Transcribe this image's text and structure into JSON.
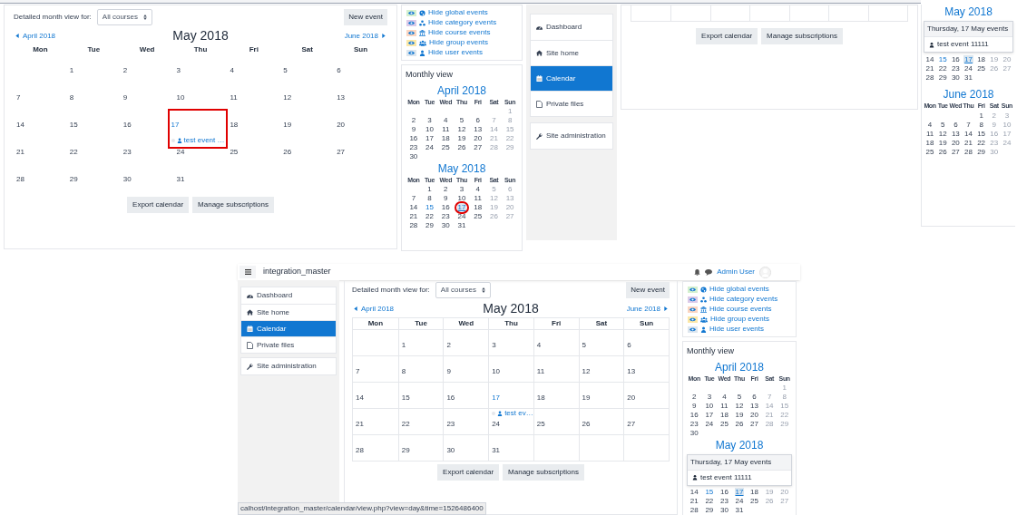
{
  "calendar_panel": {
    "filter_label": "Detailed month view for:",
    "course_select": "All courses",
    "new_event": "New event",
    "prev_month": "April 2018",
    "title": "May 2018",
    "next_month": "June 2018",
    "weekdays": [
      "Mon",
      "Tue",
      "Wed",
      "Thu",
      "Fri",
      "Sat",
      "Sun"
    ],
    "weeks": [
      [
        "1",
        "2",
        "3",
        "4",
        "5",
        "6"
      ],
      [
        "7",
        "8",
        "9",
        "10",
        "11",
        "12",
        "13"
      ],
      [
        "14",
        "15",
        "16",
        {
          "day": "17",
          "annotated": true,
          "events": [
            "test event …"
          ]
        },
        "18",
        "19",
        "20"
      ],
      [
        "21",
        "22",
        "23",
        "24",
        "25",
        "26",
        "27"
      ],
      [
        "28",
        "29",
        "30",
        "31"
      ]
    ],
    "buttons": [
      "Export calendar",
      "Manage subscriptions"
    ]
  },
  "side_blocks_panel": {
    "filters": [
      {
        "label": "Hide global events",
        "kind": "globe",
        "color": "#d4f0cf"
      },
      {
        "label": "Hide category events",
        "kind": "category",
        "color": "#dccbe9"
      },
      {
        "label": "Hide course events",
        "kind": "course",
        "color": "#fbd6c2"
      },
      {
        "label": "Hide group events",
        "kind": "group",
        "color": "#fce8a8"
      },
      {
        "label": "Hide user events",
        "kind": "user",
        "color": "#dde6ee"
      }
    ],
    "monthly_view": {
      "title": "Monthly view",
      "months": [
        {
          "title": "April 2018",
          "weekdays": [
            "Mon",
            "Tue",
            "Wed",
            "Thu",
            "Fri",
            "Sat",
            "Sun"
          ],
          "weeks": [
            [
              "1"
            ],
            [
              "2",
              "3",
              "4",
              "5",
              "6",
              "7",
              "8"
            ],
            [
              "9",
              "10",
              "11",
              "12",
              "13",
              "14",
              "15"
            ],
            [
              "16",
              "17",
              "18",
              "19",
              "20",
              "21",
              "22"
            ],
            [
              "23",
              "24",
              "25",
              "26",
              "27",
              "28",
              "29"
            ],
            [
              "30"
            ]
          ]
        },
        {
          "title": "May 2018",
          "weekdays": [
            "Mon",
            "Tue",
            "Wed",
            "Thu",
            "Fri",
            "Sat",
            "Sun"
          ],
          "weeks": [
            [
              "1",
              "2",
              "3",
              "4",
              "5",
              "6"
            ],
            [
              "7",
              "8",
              "9",
              "10",
              "11",
              "12",
              "13"
            ],
            [
              "14",
              {
                "d": "15",
                "kind": "event"
              },
              "16",
              {
                "d": "17",
                "kind": "today",
                "annotated": true
              },
              "18",
              "19",
              "20"
            ],
            [
              "21",
              "22",
              "23",
              "24",
              "25",
              "26",
              "27"
            ],
            [
              "28",
              "29",
              "30",
              "31"
            ]
          ]
        }
      ]
    }
  },
  "nav_panel": {
    "items": [
      {
        "label": "Dashboard",
        "kind": "dashboard",
        "selected": false
      },
      {
        "label": "Site home",
        "kind": "home",
        "selected": false
      },
      {
        "label": "Calendar",
        "kind": "calendar",
        "selected": true
      },
      {
        "label": "Private files",
        "kind": "files",
        "selected": false
      }
    ],
    "admin_items": [
      {
        "label": "Site administration",
        "kind": "admin",
        "selected": false
      }
    ]
  },
  "calendar_footer_panel": {
    "buttons": [
      "Export calendar",
      "Manage subscriptions"
    ]
  },
  "mini_calendar_panel": {
    "months": [
      {
        "title": "May 2018",
        "tooltip": {
          "title": "Thursday, 17 May events",
          "events": [
            "test event 11111"
          ]
        },
        "weeks": [
          [
            "14",
            {
              "d": "15",
              "kind": "event"
            },
            "16",
            {
              "d": "17",
              "kind": "today"
            },
            "18",
            "19",
            "20"
          ],
          [
            "21",
            "22",
            "23",
            "24",
            "25",
            "26",
            "27"
          ],
          [
            "28",
            "29",
            "30",
            "31"
          ]
        ]
      },
      {
        "title": "June 2018",
        "weekdays": [
          "Mon",
          "Tue",
          "Wed",
          "Thu",
          "Fri",
          "Sat",
          "Sun"
        ],
        "weeks": [
          [
            "1",
            "2",
            "3"
          ],
          [
            "4",
            "5",
            "6",
            "7",
            "8",
            "9",
            "10"
          ],
          [
            "11",
            "12",
            "13",
            "14",
            "15",
            "16",
            "17"
          ],
          [
            "18",
            "19",
            "20",
            "21",
            "22",
            "23",
            "24"
          ],
          [
            "25",
            "26",
            "27",
            "28",
            "29",
            "30"
          ]
        ]
      }
    ]
  },
  "moodle_page": {
    "header": {
      "site_name": "integration_master",
      "user_name": "Admin User"
    },
    "nav": {
      "items": [
        {
          "label": "Dashboard",
          "kind": "dashboard",
          "selected": false
        },
        {
          "label": "Site home",
          "kind": "home",
          "selected": false
        },
        {
          "label": "Calendar",
          "kind": "calendar",
          "selected": true
        },
        {
          "label": "Private files",
          "kind": "files",
          "selected": false
        }
      ],
      "admin_items": [
        {
          "label": "Site administration",
          "kind": "admin",
          "selected": false
        }
      ]
    },
    "calendar": {
      "filter_label": "Detailed month view for:",
      "course_select": "All courses",
      "new_event": "New event",
      "prev_month": "April 2018",
      "title": "May 2018",
      "next_month": "June 2018",
      "weekdays": [
        "Mon",
        "Tue",
        "Wed",
        "Thu",
        "Fri",
        "Sat",
        "Sun"
      ],
      "weeks": [
        [
          "1",
          "2",
          "3",
          "4",
          "5",
          "6"
        ],
        [
          "7",
          "8",
          "9",
          "10",
          "11",
          "12",
          "13"
        ],
        [
          "14",
          "15",
          "16",
          {
            "day": "17",
            "annotated": false,
            "events": [
              "test ev…"
            ]
          },
          "18",
          "19",
          "20"
        ],
        [
          "21",
          "22",
          "23",
          "24",
          "25",
          "26",
          "27"
        ],
        [
          "28",
          "29",
          "30",
          "31"
        ]
      ],
      "buttons": [
        "Export calendar",
        "Manage subscriptions"
      ]
    },
    "filters": [
      {
        "label": "Hide global events",
        "kind": "globe",
        "color": "#d4f0cf"
      },
      {
        "label": "Hide category events",
        "kind": "category",
        "color": "#dccbe9"
      },
      {
        "label": "Hide course events",
        "kind": "course",
        "color": "#fbd6c2"
      },
      {
        "label": "Hide group events",
        "kind": "group",
        "color": "#fce8a8"
      },
      {
        "label": "Hide user events",
        "kind": "user",
        "color": "#dde6ee"
      }
    ],
    "monthly_view": {
      "title": "Monthly view",
      "months": [
        {
          "title": "April 2018",
          "weekdays": [
            "Mon",
            "Tue",
            "Wed",
            "Thu",
            "Fri",
            "Sat",
            "Sun"
          ],
          "weeks": [
            [
              "1"
            ],
            [
              "2",
              "3",
              "4",
              "5",
              "6",
              "7",
              "8"
            ],
            [
              "9",
              "10",
              "11",
              "12",
              "13",
              "14",
              "15"
            ],
            [
              "16",
              "17",
              "18",
              "19",
              "20",
              "21",
              "22"
            ],
            [
              "23",
              "24",
              "25",
              "26",
              "27",
              "28",
              "29"
            ],
            [
              "30"
            ]
          ]
        },
        {
          "title": "May 2018",
          "tooltip": {
            "title": "Thursday, 17 May events",
            "events": [
              "test event 11111"
            ]
          },
          "weeks": [
            [
              "14",
              {
                "d": "15",
                "kind": "event"
              },
              "16",
              {
                "d": "17",
                "kind": "today"
              },
              "18",
              "19",
              "20"
            ],
            [
              "21",
              "22",
              "23",
              "24",
              "25",
              "26",
              "27"
            ],
            [
              "28",
              "29",
              "30",
              "31"
            ]
          ]
        }
      ]
    },
    "status_bar": "calhost/integration_master/calendar/view.php?view=day&time=1526486400"
  }
}
